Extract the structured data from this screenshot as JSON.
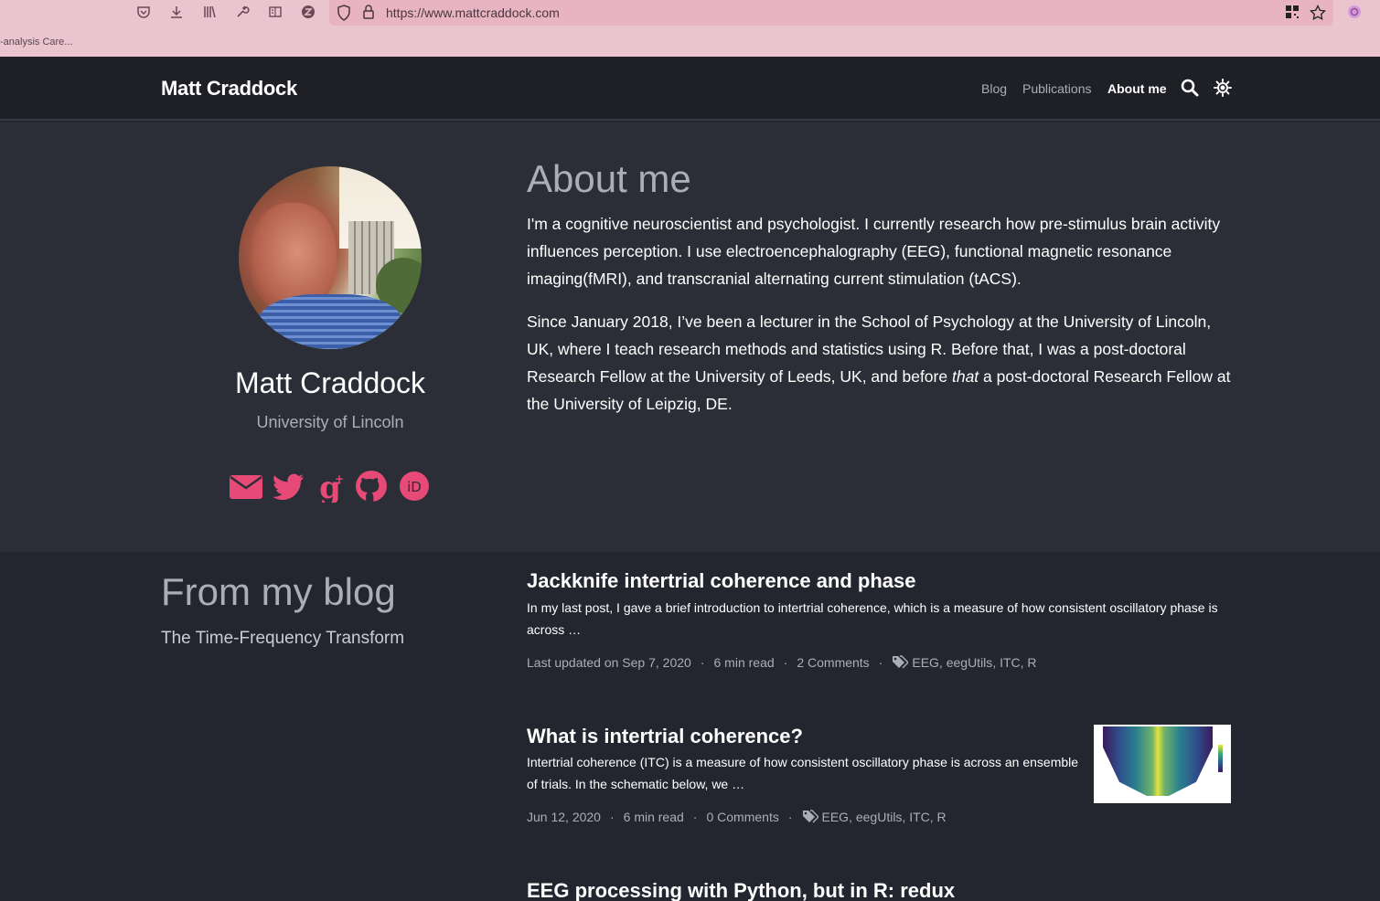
{
  "browser": {
    "url": "https://www.mattcraddock.com",
    "bookmark": "-analysis Care..."
  },
  "header": {
    "site_title": "Matt Craddock",
    "nav": [
      {
        "label": "Blog"
      },
      {
        "label": "Publications"
      },
      {
        "label": "About me"
      }
    ]
  },
  "profile": {
    "name": "Matt Craddock",
    "affiliation": "University of Lincoln",
    "accent_color": "#e84a78"
  },
  "about": {
    "title": "About me",
    "p1": "I'm a cognitive neuroscientist and psychologist. I currently research how pre-stimulus brain activity influences perception. I use electroencephalography (EEG), functional magnetic resonance imaging(fMRI), and transcranial alternating current stimulation (tACS).",
    "p2_before": "Since January 2018, I’ve been a lecturer in the School of Psychology at the University of Lincoln, UK, where I teach research methods and statistics using R. Before that, I was a post-doctoral Research Fellow at the University of Leeds, UK, and before ",
    "p2_em": "that",
    "p2_after": " a post-doctoral Research Fellow at the University of Leipzig, DE."
  },
  "blog": {
    "heading": "From my blog",
    "sublink": "The Time-Frequency Transform",
    "posts": [
      {
        "title": "Jackknife intertrial coherence and phase",
        "excerpt": "In my last post, I gave a brief introduction to intertrial coherence, which is a measure of how consistent oscillatory phase is across …",
        "date": "Last updated on Sep 7, 2020",
        "read_time": "6 min read",
        "comments": "2 Comments",
        "tags": "EEG, eegUtils, ITC, R"
      },
      {
        "title": "What is intertrial coherence?",
        "excerpt": "Intertrial coherence (ITC) is a measure of how consistent oscillatory phase is across an ensemble of trials. In the schematic below, we …",
        "date": "Jun 12, 2020",
        "read_time": "6 min read",
        "comments": "0 Comments",
        "tags": "EEG, eegUtils, ITC, R"
      },
      {
        "title": "EEG processing with Python, but in R: redux"
      }
    ]
  }
}
